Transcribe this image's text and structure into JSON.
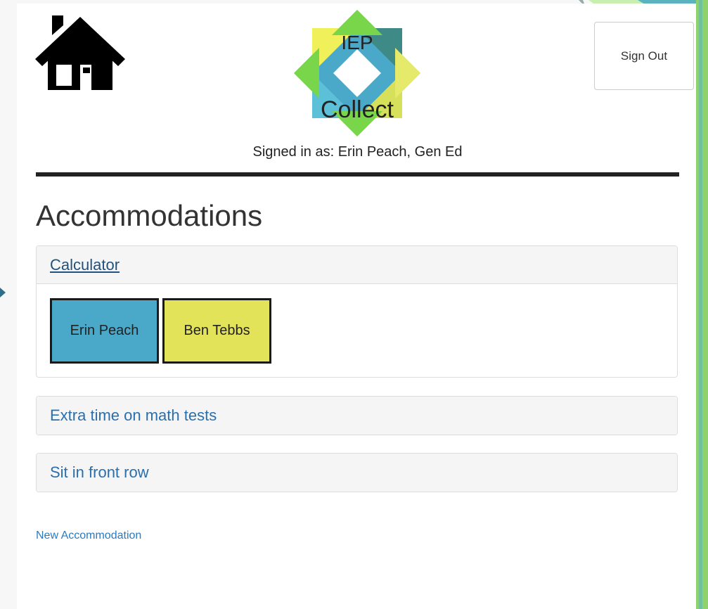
{
  "header": {
    "home_icon": "house-icon",
    "logo": {
      "line1": "IEP",
      "line2": "Collect"
    },
    "sign_out_label": "Sign Out",
    "signed_in_text": "Signed in as: Erin Peach, Gen Ed"
  },
  "page": {
    "title": "Accommodations",
    "new_accommodation_label": "New Accommodation"
  },
  "accommodations": [
    {
      "title": "Calculator",
      "expanded": true,
      "students": [
        {
          "name": "Erin Peach",
          "color": "#4aa8c9"
        },
        {
          "name": "Ben Tebbs",
          "color": "#e3e35a"
        }
      ]
    },
    {
      "title": "Extra time on math tests",
      "expanded": false
    },
    {
      "title": "Sit in front row",
      "expanded": false
    }
  ],
  "colors": {
    "link": "#2a6fad",
    "active_link": "#23527c",
    "panel_heading_bg": "#f5f5f5",
    "accent_green": "#8fd16a",
    "accent_blue": "#56b7c8"
  }
}
